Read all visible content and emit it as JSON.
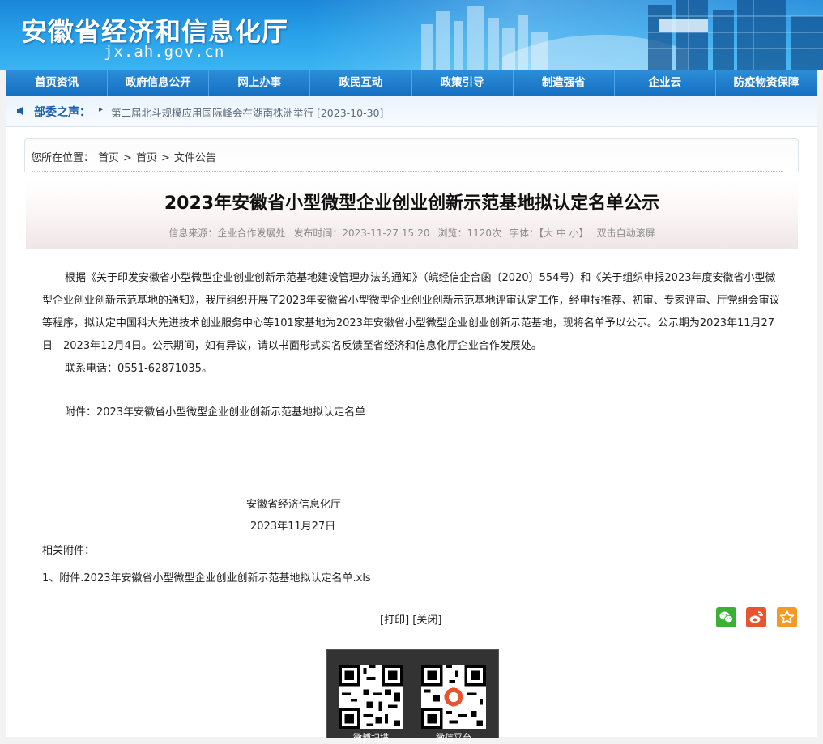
{
  "header": {
    "site_title": "安徽省经济和信息化厅",
    "site_domain": "jx.ah.gov.cn"
  },
  "nav": {
    "items": [
      "首页资讯",
      "政府信息公开",
      "网上办事",
      "政民互动",
      "政策引导",
      "制造强省",
      "企业云",
      "防疫物资保障"
    ]
  },
  "ticker": {
    "label": "部委之声：",
    "text": "第二届北斗规模应用国际峰会在湖南株洲举行 [2023-10-30]"
  },
  "breadcrumb": {
    "prefix": "您所在位置：",
    "items": [
      "首页",
      ">",
      "首页",
      ">",
      "文件公告"
    ]
  },
  "article": {
    "title": "2023年安徽省小型微型企业创业创新示范基地拟认定名单公示",
    "meta": {
      "source": "信息来源：企业合作发展处",
      "time": "发布时间：2023-11-27 15:20",
      "views": "浏览：1120次",
      "font_label": "字体：",
      "font_sizes": "【大 中 小】",
      "autoscroll": "双击自动滚屏"
    },
    "paragraph": "根据《关于印发安徽省小型微型企业创业创新示范基地建设管理办法的通知》（皖经信企合函〔2020〕554号）和《关于组织申报2023年度安徽省小型微型企业创业创新示范基地的通知》，我厅组织开展了2023年安徽省小型微型企业创业创新示范基地评审认定工作，经申报推荐、初审、专家评审、厅党组会审议等程序，拟认定中国科大先进技术创业服务中心等101家基地为2023年安徽省小型微型企业创业创新示范基地，现将名单予以公示。公示期为2023年11月27日—2023年12月4日。公示期间，如有异议，请以书面形式实名反馈至省经济和信息化厅企业合作发展处。",
    "contact": "联系电话：0551-62871035。",
    "attachment_note": "附件：2023年安徽省小型微型企业创业创新示范基地拟认定名单",
    "sign_org": "安徽省经济信息化厅",
    "sign_date": "2023年11月27日",
    "related_label": "相关附件：",
    "related_file": "1、附件.2023年安徽省小型微型企业创业创新示范基地拟认定名单.xls"
  },
  "actions": {
    "print": "[打印]",
    "close": "[关闭]"
  },
  "share": {
    "wechat_icon": "wechat-icon",
    "weibo_icon": "weibo-icon",
    "favorite_icon": "star-icon",
    "colors": {
      "wechat": "#3cb034",
      "weibo": "#e8542f",
      "favorite": "#f39a26"
    }
  },
  "qr": {
    "captions": [
      "微博扫描",
      "微信平台"
    ]
  },
  "colors": {
    "nav_bg": "#1670c2",
    "banner": "#1a86d8",
    "ticker_label": "#1a5ea8"
  }
}
